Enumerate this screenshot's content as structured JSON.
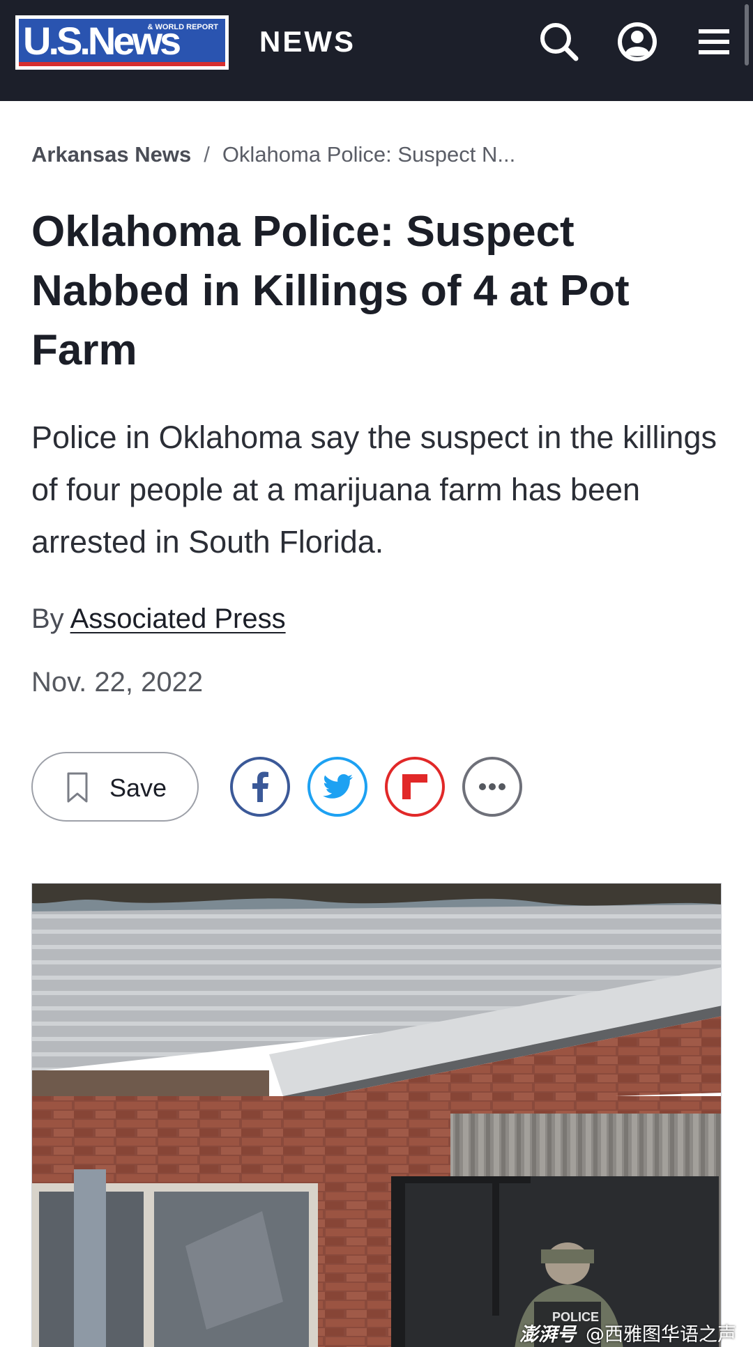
{
  "header": {
    "logo_text": "U.S.News",
    "logo_tagline": "& WORLD REPORT",
    "section_label": "NEWS",
    "icons": [
      "search-icon",
      "account-icon",
      "menu-icon"
    ]
  },
  "breadcrumb": {
    "parent": "Arkansas News",
    "separator": "/",
    "current": "Oklahoma Police: Suspect N..."
  },
  "article": {
    "headline": "Oklahoma Police: Suspect Nabbed in Killings of 4 at Pot Farm",
    "dek": "Police in Oklahoma say the suspect in the killings of four people at a marijuana farm has been arrested in South Florida.",
    "byline_prefix": "By",
    "author": "Associated Press",
    "date": "Nov. 22, 2022"
  },
  "actions": {
    "save_label": "Save",
    "share_icons": [
      "facebook-icon",
      "twitter-icon",
      "flipboard-icon",
      "more-icon"
    ]
  },
  "photo": {
    "vest_text": "POLICE"
  },
  "watermark": {
    "brand": "澎湃号",
    "handle": "@西雅图华语之声"
  },
  "colors": {
    "header_bg": "#1c1f2a",
    "logo_blue": "#2a54b0",
    "logo_red": "#d62f2f",
    "facebook": "#3b5998",
    "twitter": "#1da1f2",
    "flipboard": "#e12828",
    "more": "#6e7079"
  }
}
